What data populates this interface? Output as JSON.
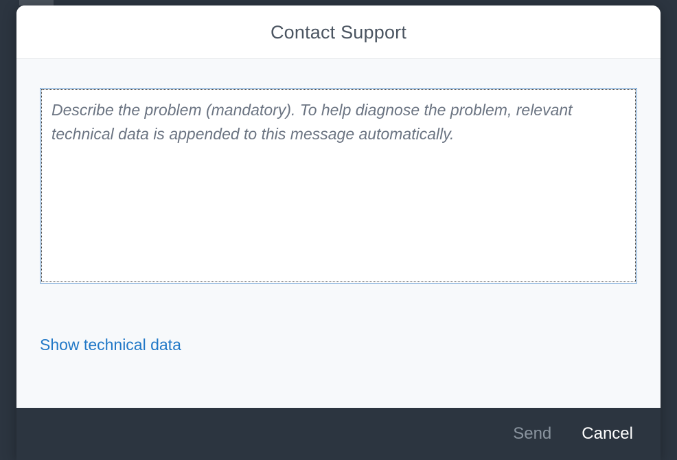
{
  "dialog": {
    "title": "Contact Support",
    "problem_placeholder": "Describe the problem (mandatory). To help diagnose the problem, relevant technical data is appended to this message automatically.",
    "problem_value": "",
    "tech_link_label": "Show technical data",
    "footer": {
      "send_label": "Send",
      "cancel_label": "Cancel"
    }
  }
}
